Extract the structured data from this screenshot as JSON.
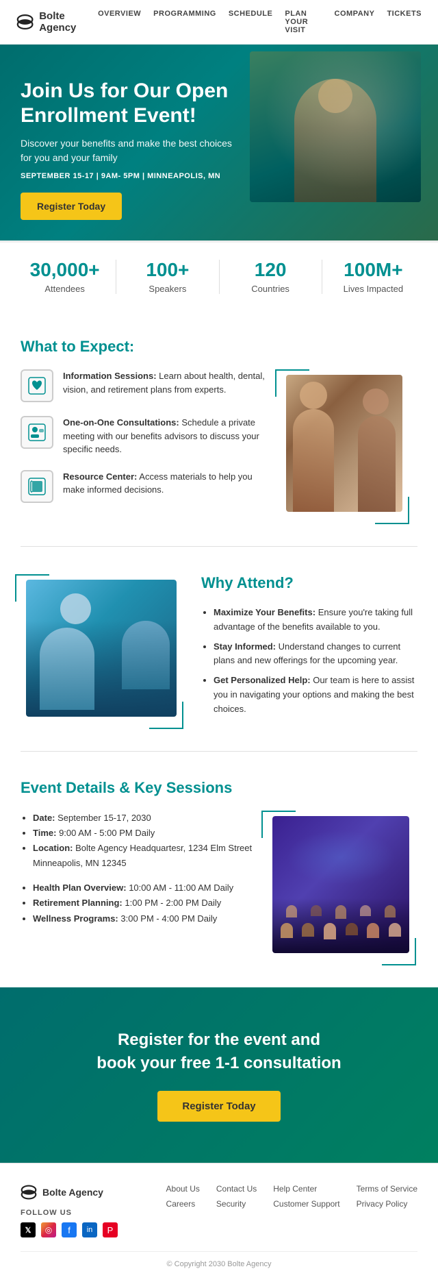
{
  "nav": {
    "logo_text": "Bolte Agency",
    "links": [
      "OVERVIEW",
      "PROGRAMMING",
      "SCHEDULE",
      "PLAN YOUR VISIT",
      "COMPANY",
      "TICKETS"
    ]
  },
  "hero": {
    "title": "Join Us for Our Open Enrollment Event!",
    "description": "Discover your benefits and make the best choices for you and your family",
    "date_line": "SEPTEMBER 15-17 | 9AM- 5PM | MINNEAPOLIS, MN",
    "register_btn": "Register Today"
  },
  "stats": [
    {
      "number": "30,000+",
      "label": "Attendees"
    },
    {
      "number": "100+",
      "label": "Speakers"
    },
    {
      "number": "120",
      "label": "Countries"
    },
    {
      "number": "100M+",
      "label": "Lives Impacted"
    }
  ],
  "what_to_expect": {
    "title": "What to Expect:",
    "items": [
      {
        "heading": "Information Sessions:",
        "text": "Learn about health, dental, vision, and retirement plans from experts."
      },
      {
        "heading": "One-on-One Consultations:",
        "text": "Schedule a private meeting with our benefits advisors to discuss your specific needs."
      },
      {
        "heading": "Resource Center:",
        "text": "Access materials to help you make informed decisions."
      }
    ]
  },
  "why_attend": {
    "title": "Why Attend?",
    "items": [
      {
        "heading": "Maximize Your Benefits:",
        "text": "Ensure you're taking full advantage of the benefits available to you."
      },
      {
        "heading": "Stay Informed:",
        "text": "Understand changes to current plans and new offerings for the upcoming year."
      },
      {
        "heading": "Get Personalized Help:",
        "text": "Our team is here to assist you in navigating your options and making the best choices."
      }
    ]
  },
  "event_details": {
    "title": "Event Details & Key Sessions",
    "basics": [
      {
        "label": "Date:",
        "text": "September 15-17, 2030"
      },
      {
        "label": "Time:",
        "text": "9:00 AM - 5:00 PM Daily"
      },
      {
        "label": "Location:",
        "text": "Bolte Agency Headquartesr, 1234 Elm Street Minneapolis, MN 12345"
      }
    ],
    "sessions": [
      {
        "label": "Health Plan Overview:",
        "text": "10:00 AM - 11:00 AM Daily"
      },
      {
        "label": "Retirement Planning:",
        "text": "1:00 PM - 2:00 PM Daily"
      },
      {
        "label": "Wellness Programs:",
        "text": "3:00 PM - 4:00 PM Daily"
      }
    ]
  },
  "cta": {
    "title": "Register for the event and\nbook your free 1-1 consultation",
    "btn": "Register Today"
  },
  "footer": {
    "logo": "Bolte Agency",
    "follow_label": "FOLLOW US",
    "social": [
      "X",
      "📷",
      "f",
      "in",
      "P"
    ],
    "links": [
      "About Us",
      "Contact Us",
      "Help Center",
      "Terms of Service",
      "Careers",
      "Security",
      "Customer Support",
      "Privacy Policy"
    ],
    "copyright": "© Copyright 2030 Bolte Agency"
  }
}
